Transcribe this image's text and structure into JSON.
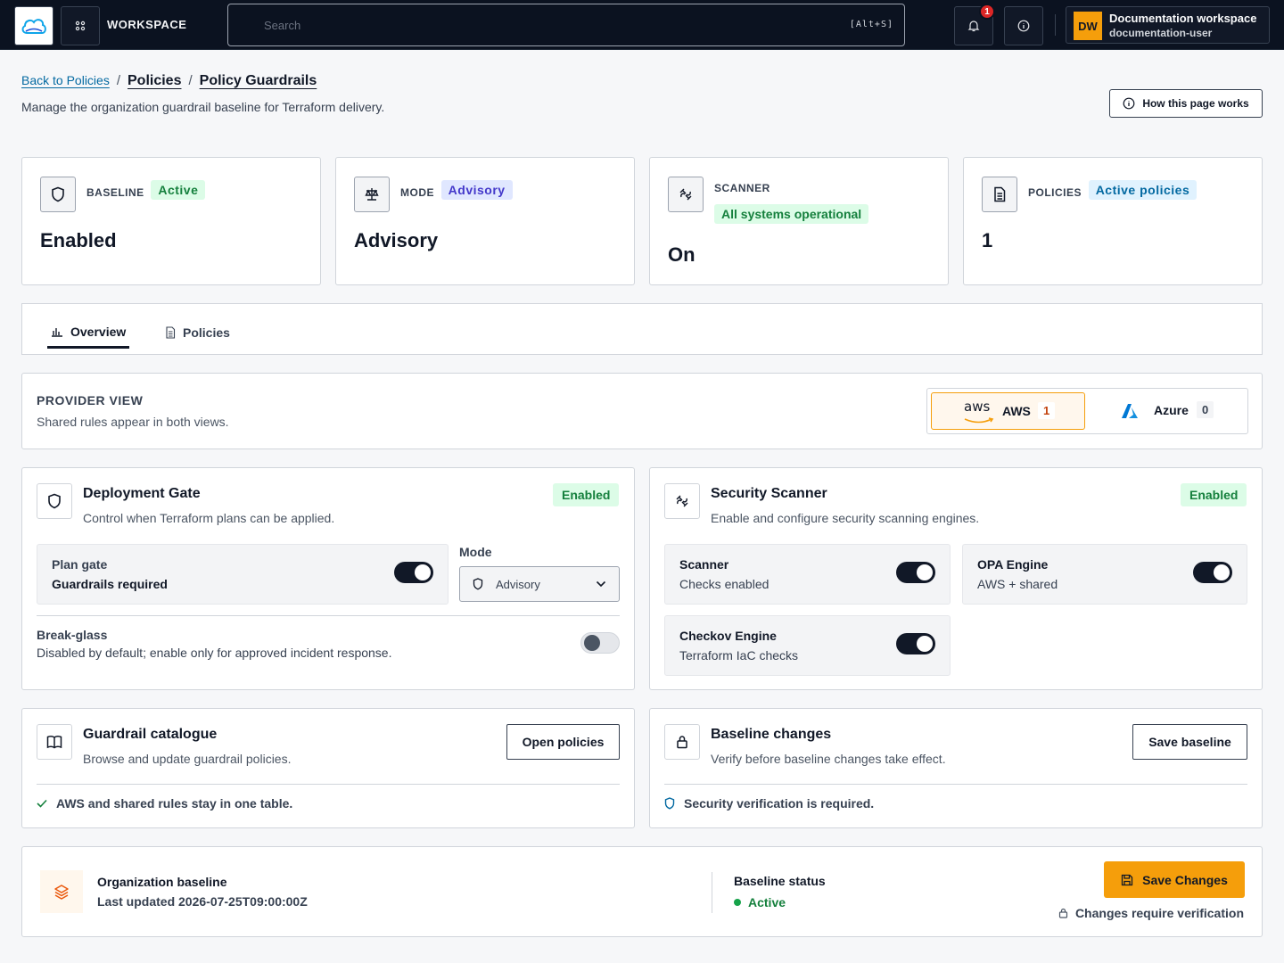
{
  "topbar": {
    "workspace_label": "WORKSPACE",
    "search_placeholder": "Search",
    "search_shortcut": "[Alt+S]",
    "notification_count": "1",
    "account_initials": "DW",
    "account_name": "Documentation workspace",
    "account_user": "documentation-user"
  },
  "header": {
    "back_link": "Back to Policies",
    "breadcrumb_parent": "Policies",
    "breadcrumb_current": "Policy Guardrails",
    "subtitle": "Manage the organization guardrail baseline for Terraform delivery.",
    "how_button": "How this page works"
  },
  "stats": [
    {
      "label": "BASELINE",
      "badge": "Active",
      "value": "Enabled"
    },
    {
      "label": "MODE",
      "badge": "Advisory",
      "value": "Advisory"
    },
    {
      "label": "SCANNER",
      "badge": "All systems operational",
      "value": "On"
    },
    {
      "label": "POLICIES",
      "badge": "Active policies",
      "value": "1"
    }
  ],
  "tabs": [
    {
      "label": "Overview",
      "active": true
    },
    {
      "label": "Policies",
      "active": false
    }
  ],
  "provider_view": {
    "title": "PROVIDER VIEW",
    "subtitle": "Shared rules appear in both views.",
    "options": [
      {
        "logo_text": "aws",
        "label": "AWS",
        "count": "1",
        "selected": true
      },
      {
        "label": "Azure",
        "count": "0",
        "selected": false
      }
    ]
  },
  "deployment_gate": {
    "title": "Deployment Gate",
    "subtitle": "Control when Terraform plans can be applied.",
    "status": "Enabled",
    "plan_gate_label": "Plan gate",
    "plan_gate_value": "Guardrails required",
    "plan_gate_on": true,
    "mode_label": "Mode",
    "mode_value": "Advisory",
    "break_glass_title": "Break-glass",
    "break_glass_desc": "Disabled by default; enable only for approved incident response.",
    "break_glass_on": false
  },
  "security_scanner": {
    "title": "Security Scanner",
    "subtitle": "Enable and configure security scanning engines.",
    "status": "Enabled",
    "engines": [
      {
        "name": "Scanner",
        "desc": "Checks enabled",
        "on": true
      },
      {
        "name": "OPA Engine",
        "desc": "AWS + shared",
        "on": true
      },
      {
        "name": "Checkov Engine",
        "desc": "Terraform IaC checks",
        "on": true
      }
    ]
  },
  "catalogue": {
    "title": "Guardrail catalogue",
    "subtitle": "Browse and update guardrail policies.",
    "button": "Open policies",
    "note": "AWS and shared rules stay in one table."
  },
  "baseline_changes": {
    "title": "Baseline changes",
    "subtitle": "Verify before baseline changes take effect.",
    "button": "Save baseline",
    "note": "Security verification is required."
  },
  "footer": {
    "org_title": "Organization baseline",
    "last_updated": "Last updated 2026-07-25T09:00:00Z",
    "status_title": "Baseline status",
    "status_value": "Active",
    "save_button": "Save Changes",
    "verify_note": "Changes require verification"
  },
  "colors": {
    "topbar_bg": "#0b1220",
    "accent": "#f59e0b",
    "success": "#15803d",
    "link": "#0369a1"
  }
}
